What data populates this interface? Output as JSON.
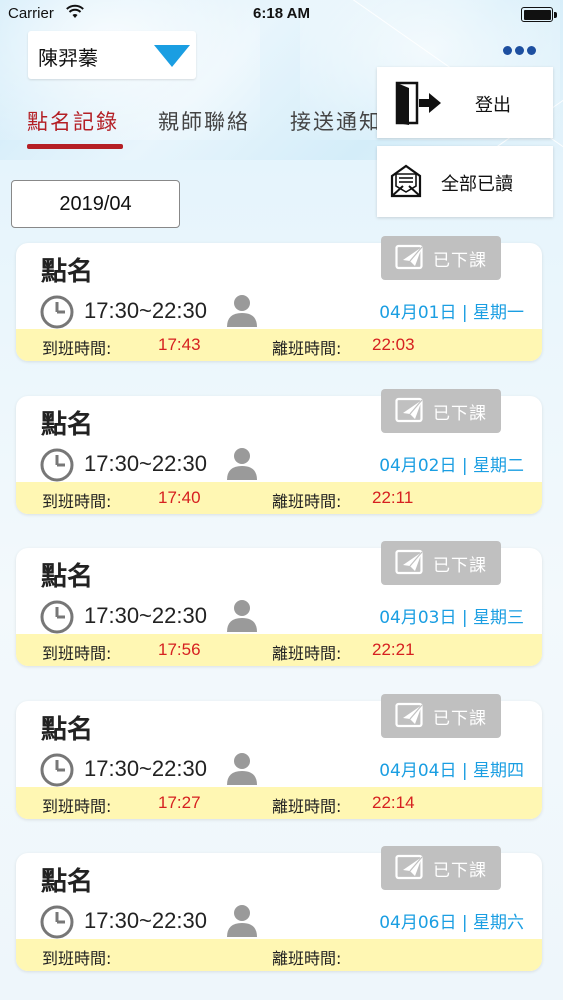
{
  "status_bar": {
    "carrier": "Carrier",
    "time": "6:18 AM"
  },
  "header": {
    "student_name": "陳羿蓁"
  },
  "tabs": [
    {
      "label": "點名記錄",
      "active": true
    },
    {
      "label": "親師聯絡",
      "active": false
    },
    {
      "label": "接送通知",
      "active": false
    }
  ],
  "menu": {
    "logout_label": "登出",
    "read_all_label": "全部已讀"
  },
  "month": "2019/04",
  "colors": {
    "accent_red": "#b41f25",
    "accent_blue": "#1a9ee2",
    "strip_yellow": "#fff7b3",
    "badge_gray": "#c0c0c0"
  },
  "labels": {
    "arrive": "到班時間:",
    "leave": "離班時間:"
  },
  "records": [
    {
      "title": "點名",
      "time_range": "17:30~22:30",
      "date": "04月01日 | 星期一",
      "arrive": "17:43",
      "leave": "22:03",
      "badge": "已下課"
    },
    {
      "title": "點名",
      "time_range": "17:30~22:30",
      "date": "04月02日 | 星期二",
      "arrive": "17:40",
      "leave": "22:11",
      "badge": "已下課"
    },
    {
      "title": "點名",
      "time_range": "17:30~22:30",
      "date": "04月03日 | 星期三",
      "arrive": "17:56",
      "leave": "22:21",
      "badge": "已下課"
    },
    {
      "title": "點名",
      "time_range": "17:30~22:30",
      "date": "04月04日 | 星期四",
      "arrive": "17:27",
      "leave": "22:14",
      "badge": "已下課"
    },
    {
      "title": "點名",
      "time_range": "17:30~22:30",
      "date": "04月06日 | 星期六",
      "arrive": "",
      "leave": "",
      "badge": "已下課"
    }
  ]
}
